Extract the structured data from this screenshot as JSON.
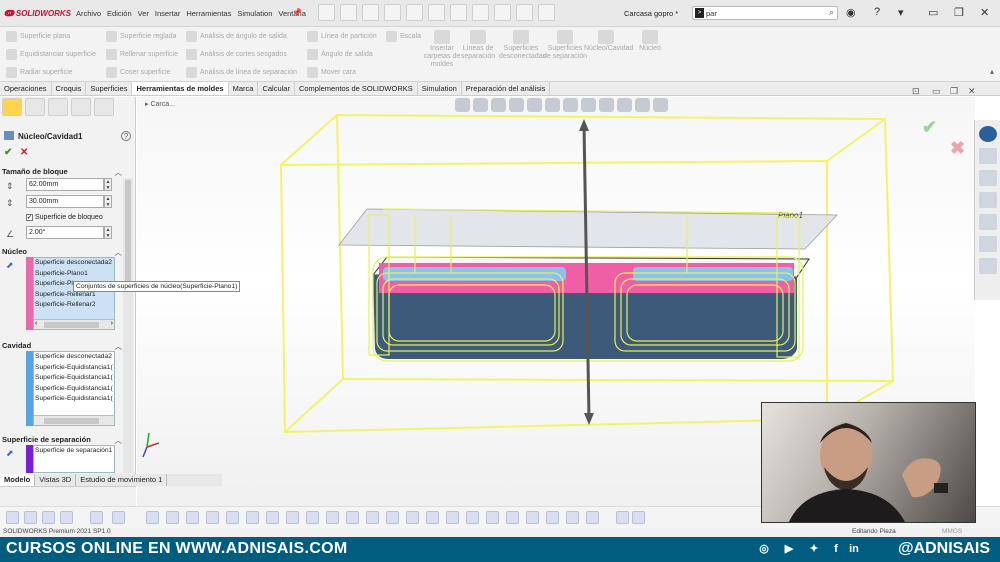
{
  "app": {
    "logo": "SOLIDWORKS",
    "menu": [
      "Archivo",
      "Edición",
      "Ver",
      "Insertar",
      "Herramientas",
      "Simulation",
      "Ventana"
    ],
    "document_name": "Carcasa gopro *",
    "search_value": "par"
  },
  "ribbon": {
    "col1": [
      "Superficie plana",
      "Equidistanciar superficie",
      "Radiar superficie"
    ],
    "col2": [
      "Superficie reglada",
      "Rellenar superficie",
      "Coser superficie"
    ],
    "col3": [
      "Análisis de ángulo de salida",
      "Análisis de cortes sesgados",
      "Análisis de línea de separación"
    ],
    "col4": [
      "Línea de partición",
      "Ángulo de salida",
      "Mover cara"
    ],
    "escala": "Escala",
    "big": [
      "Insertar carpetas de moldes",
      "Líneas de separación",
      "Superficies desconectadas",
      "Superficies de separación",
      "Núcleo/Cavidad",
      "Núcleo"
    ]
  },
  "tabs": [
    "Operaciones",
    "Croquis",
    "Superficies",
    "Herramientas de moldes",
    "Marca",
    "Calcular",
    "Complementos de SOLIDWORKS",
    "Simulation",
    "Preparación del análisis"
  ],
  "active_tab": "Herramientas de moldes",
  "property_manager": {
    "title": "Núcleo/Cavidad1",
    "block_size": {
      "label": "Tamaño de bloque",
      "dim1": "62.00mm",
      "dim2": "30.00mm",
      "interlock_label": "Superficie de bloqueo",
      "angle": "2.00°"
    },
    "core": {
      "label": "Núcleo",
      "items": [
        "Superficie desconectada2",
        "Superficie-Plano1",
        "Superficie-Pl",
        "Superficie-Rellenar1",
        "Superficie-Rellenar2"
      ]
    },
    "cavity": {
      "label": "Cavidad",
      "items": [
        "Superficie desconectada2",
        "Superficie-Equidistancia1(",
        "Superficie-Equidistancia1(",
        "Superficie-Equidistancia1(",
        "Superficie-Equidistancia1("
      ]
    },
    "parting": {
      "label": "Superficie de separación",
      "items": [
        "Superficie de separación1"
      ]
    },
    "tooltip": "Conjuntos de superficies de núcleo(Superficie-Plano1)",
    "core_color": "#e86aa8",
    "cavity_color": "#5aa3e0",
    "parting_color": "#7a1fd6"
  },
  "bottom_tabs": [
    "Modelo",
    "Vistas 3D",
    "Estudio de movimiento 1"
  ],
  "viewport": {
    "breadcrumb": "Carca...",
    "plane_label": "Plano1"
  },
  "status": {
    "version": "SOLIDWORKS Premium 2021 SP1.0",
    "mode": "Editando Pieza",
    "units": "MMGS"
  },
  "banner": {
    "left": "CURSOS ONLINE EN WWW.ADNISAIS.COM",
    "right": "@ADNISAIS",
    "bg": "#005d7f"
  }
}
